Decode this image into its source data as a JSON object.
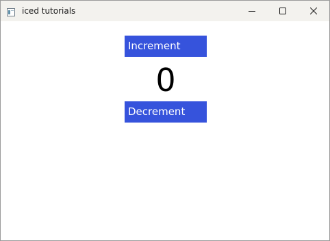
{
  "window": {
    "title": "iced tutorials"
  },
  "icons": {
    "app": "app-window-icon",
    "minimize": "minimize-icon",
    "maximize": "maximize-icon",
    "close": "close-icon"
  },
  "controls": {
    "increment_label": "Increment",
    "counter_value": "0",
    "decrement_label": "Decrement"
  },
  "colors": {
    "button_bg": "#3653dc",
    "button_text": "#ffffff",
    "titlebar_bg": "#f3f2ee",
    "window_bg": "#ffffff"
  }
}
